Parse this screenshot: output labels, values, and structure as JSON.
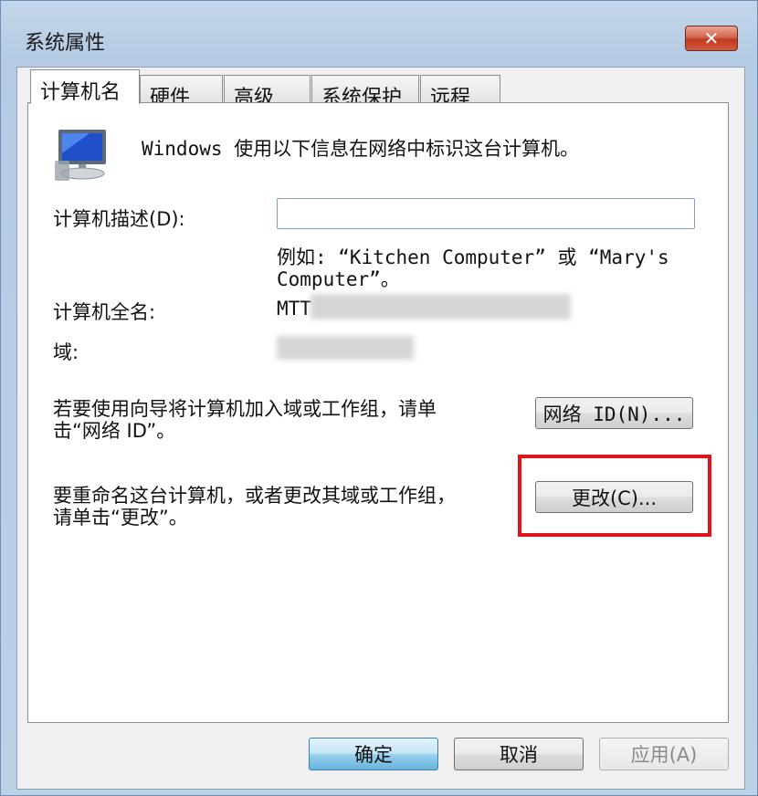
{
  "window": {
    "title": "系统属性"
  },
  "tabs": [
    {
      "label": "计算机名",
      "active": true
    },
    {
      "label": "硬件",
      "active": false
    },
    {
      "label": "高级",
      "active": false
    },
    {
      "label": "系统保护",
      "active": false
    },
    {
      "label": "远程",
      "active": false
    }
  ],
  "computer_name": {
    "intro": "Windows 使用以下信息在网络中标识这台计算机。",
    "description_label": "计算机描述(D):",
    "description_value": "",
    "example_line1": "例如: “Kitchen Computer” 或 “Mary's",
    "example_line2": "Computer”。",
    "full_name_label": "计算机全名:",
    "full_name_value": "MTT",
    "domain_label": "域:",
    "network_id_text_line1": "若要使用向导将计算机加入域或工作组，请单",
    "network_id_text_line2": "击“网络 ID”。",
    "network_id_button": "网络 ID(N)...",
    "rename_text_line1": "要重命名这台计算机，或者更改其域或工作组，",
    "rename_text_line2": "请单击“更改”。",
    "change_button": "更改(C)..."
  },
  "footer": {
    "ok_label": "确定",
    "cancel_label": "取消",
    "apply_label": "应用(A)"
  },
  "colors": {
    "highlight": "#e0141e",
    "accent": "#3c7fb1"
  }
}
